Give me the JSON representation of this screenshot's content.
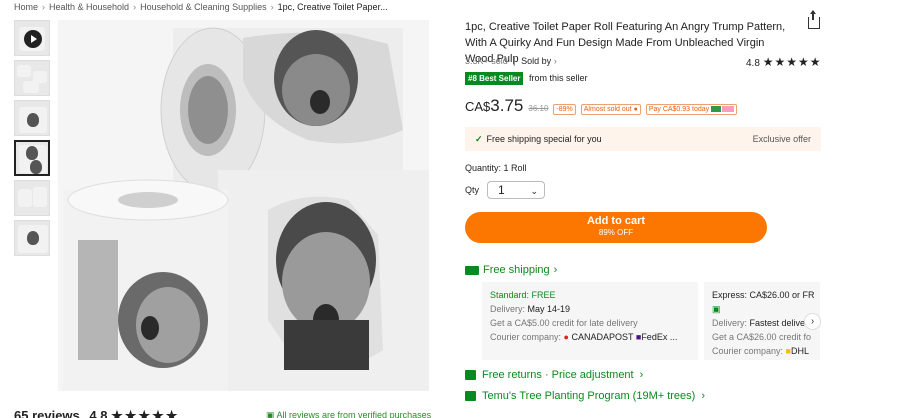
{
  "breadcrumb": [
    "Home",
    "Health & Household",
    "Household & Cleaning Supplies",
    "1pc, Creative Toilet Paper..."
  ],
  "product": {
    "title": "1pc, Creative Toilet Paper Roll Featuring An Angry Trump Pattern, With A Quirky And Fun Design Made From Unbleached Virgin Wood Pulp",
    "sold": "3.3K+ sold",
    "sold_by": "Sold by",
    "rating": "4.8",
    "stars": "★★★★★",
    "best_seller": "#8 Best Seller",
    "from_seller": "from this seller"
  },
  "price": {
    "currency": "CA$",
    "amount": "3.75",
    "old": "36.10",
    "discount": "-89%",
    "almost_sold_out": "Almost sold out",
    "pay_today": "Pay CA$0.93 today"
  },
  "shipping_banner": {
    "text": "Free shipping special for you",
    "offer": "Exclusive offer"
  },
  "quantity": {
    "label": "Quantity: 1 Roll",
    "qty_label": "Qty",
    "value": "1"
  },
  "cart": {
    "label": "Add to cart",
    "sub": "89% OFF"
  },
  "free_shipping": "Free shipping",
  "card_standard": {
    "title": "Standard: FREE",
    "delivery_label": "Delivery:",
    "delivery": "May 14-19",
    "credit": "Get a CA$5.00 credit for late delivery",
    "courier_label": "Courier company:",
    "couriers": "CANADAPOST",
    "courier2": "FedEx ..."
  },
  "card_express": {
    "title": "Express: CA$26.00 or FR",
    "delivery_label": "Delivery:",
    "delivery": "Fastest deliver",
    "credit": "Get a CA$26.00 credit fo",
    "courier_label": "Courier company:",
    "courier": "DHL"
  },
  "returns": "Free returns · Price adjustment",
  "trees": "Temu's Tree Planting Program (19M+ trees)",
  "reviews": {
    "count": "65 reviews",
    "rating": "4.8",
    "stars": "★★★★★",
    "verified": "All reviews are from verified purchases"
  },
  "colors": {
    "accent": "#fb7701",
    "green": "#0a8a1e"
  }
}
